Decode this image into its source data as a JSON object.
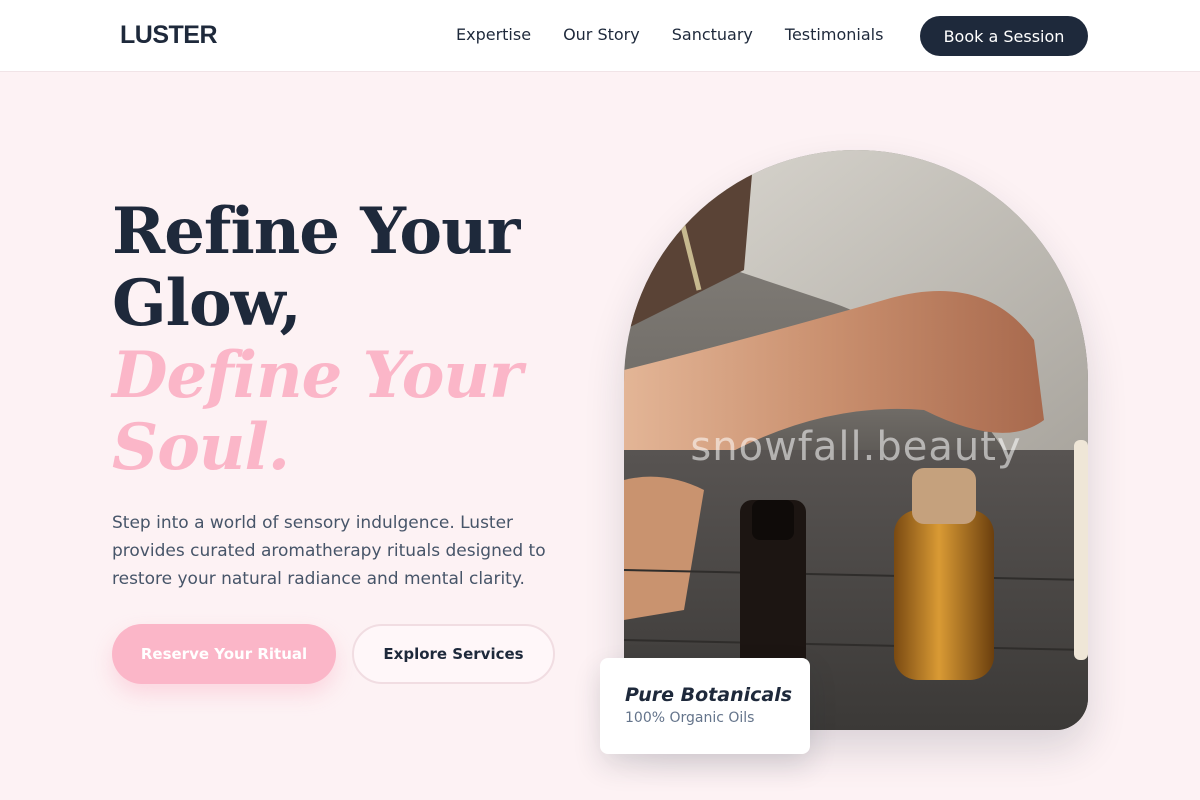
{
  "nav": {
    "logo": "LUSTER",
    "links": [
      {
        "label": "Expertise"
      },
      {
        "label": "Our Story"
      },
      {
        "label": "Sanctuary"
      },
      {
        "label": "Testimonials"
      }
    ],
    "cta": "Book a Session"
  },
  "hero": {
    "headline_line1": "Refine Your",
    "headline_line2": "Glow,",
    "accent_line1": "Define Your",
    "accent_line2": "Soul.",
    "description": "Step into a world of sensory indulgence. Luster provides curated aromatherapy rituals designed to restore your natural radiance and mental clarity.",
    "primary_button": "Reserve Your Ritual",
    "secondary_button": "Explore Services"
  },
  "image": {
    "watermark": "snowfall.beauty"
  },
  "badge": {
    "title": "Pure Botanicals",
    "subtitle": "100% Organic Oils"
  },
  "colors": {
    "navy": "#1e293b",
    "pink_accent": "#fbb6c8",
    "background": "#fdf2f4"
  }
}
